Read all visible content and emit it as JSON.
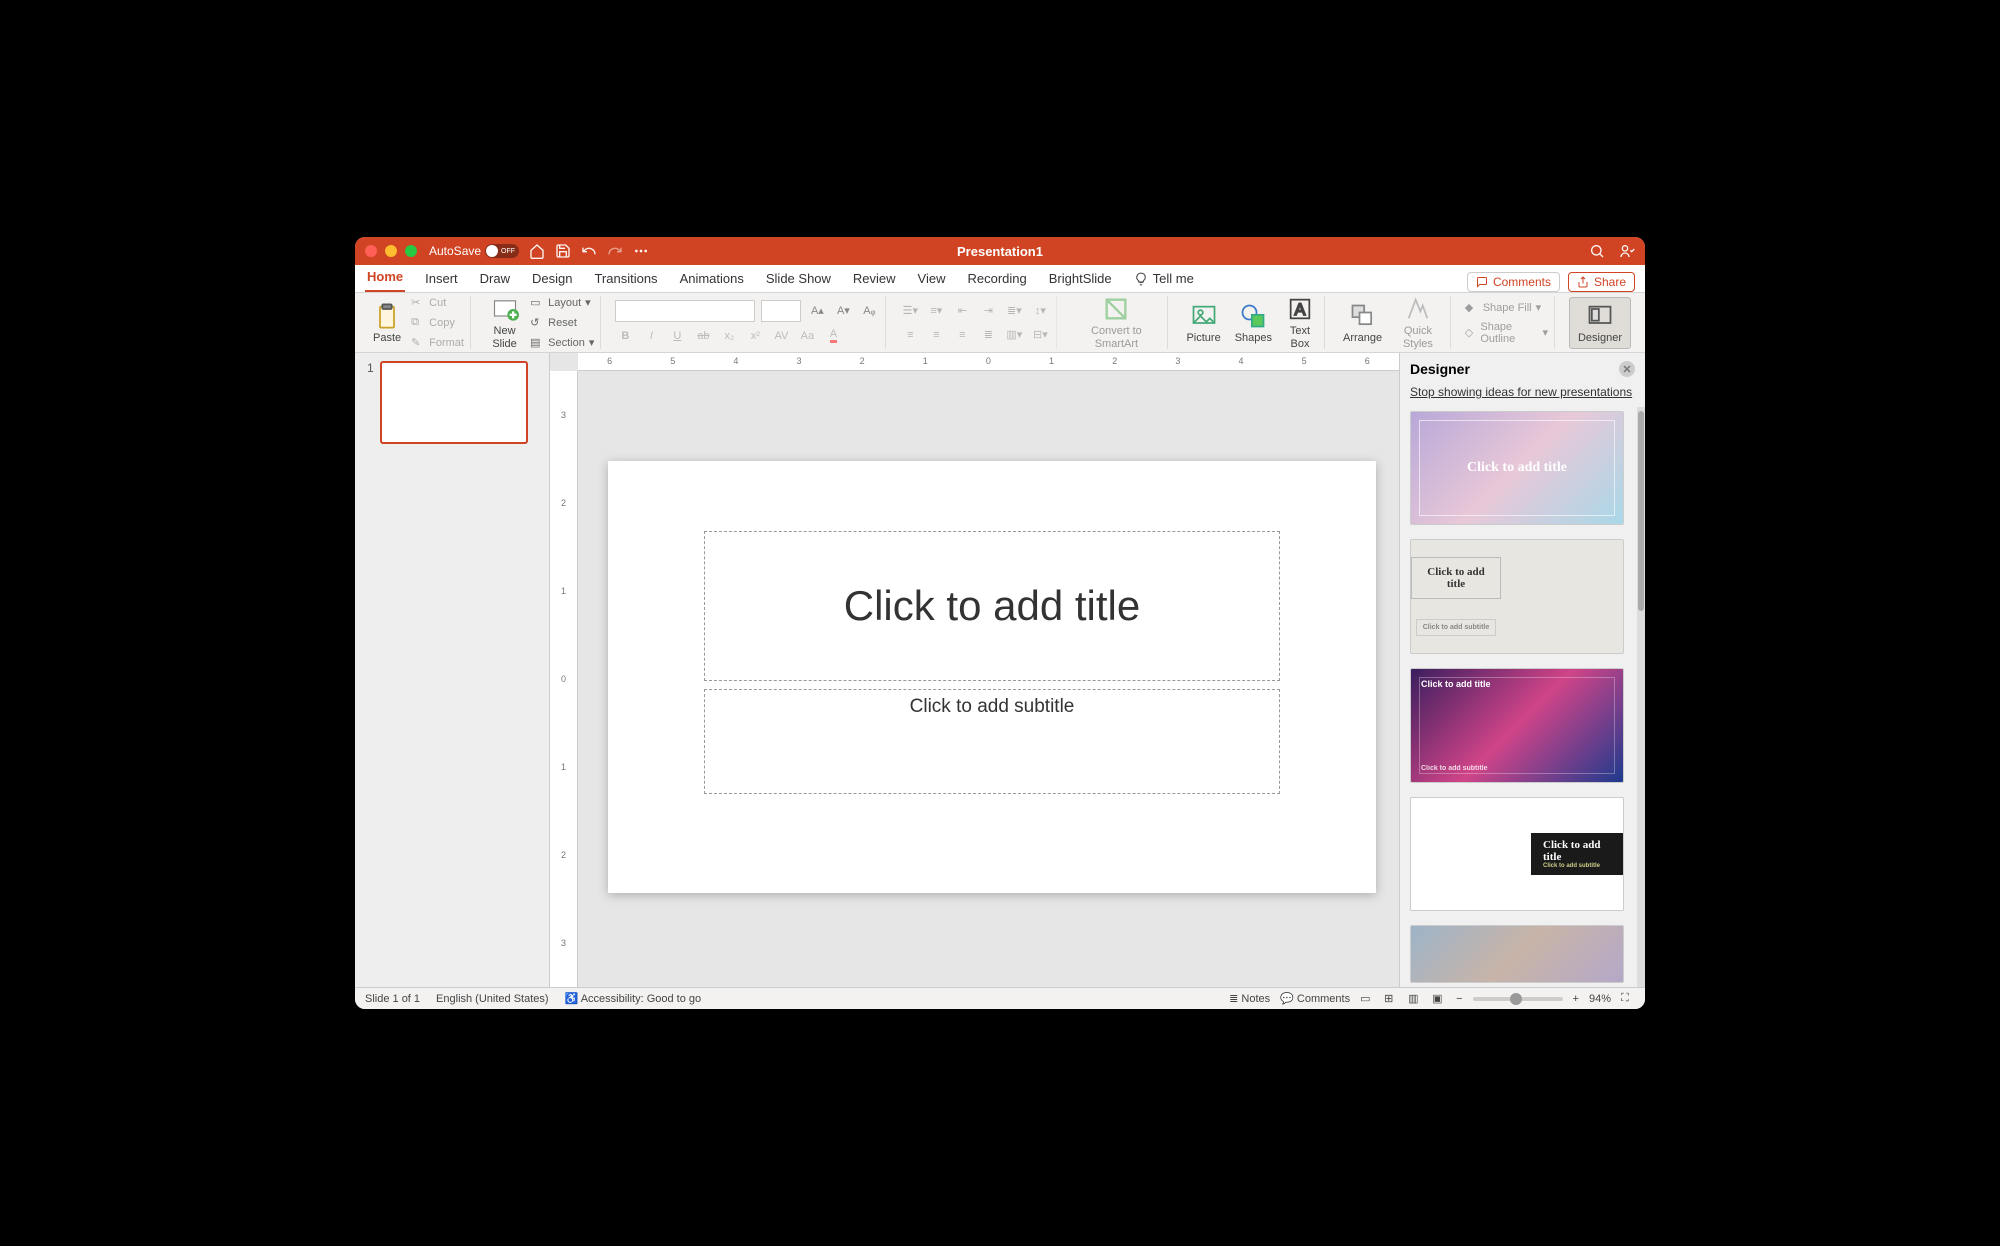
{
  "titlebar": {
    "autosave": "AutoSave",
    "autosave_state": "OFF",
    "title": "Presentation1"
  },
  "tabs": [
    "Home",
    "Insert",
    "Draw",
    "Design",
    "Transitions",
    "Animations",
    "Slide Show",
    "Review",
    "View",
    "Recording",
    "BrightSlide",
    "Tell me"
  ],
  "toolbar": {
    "comments": "Comments",
    "share": "Share"
  },
  "ribbon": {
    "paste": "Paste",
    "cut": "Cut",
    "copy": "Copy",
    "format": "Format",
    "new_slide": "New\nSlide",
    "layout": "Layout",
    "reset": "Reset",
    "section": "Section",
    "smartart": "Convert to\nSmartArt",
    "picture": "Picture",
    "shapes": "Shapes",
    "textbox": "Text\nBox",
    "arrange": "Arrange",
    "quick_styles": "Quick\nStyles",
    "shape_fill": "Shape Fill",
    "shape_outline": "Shape Outline",
    "designer": "Designer"
  },
  "thumbnails": [
    {
      "number": "1"
    }
  ],
  "slide": {
    "title_placeholder": "Click to add title",
    "subtitle_placeholder": "Click to add subtitle"
  },
  "designer": {
    "title": "Designer",
    "stop_link": "Stop showing ideas for new presentations",
    "ideas": [
      {
        "title": "Click to add title"
      },
      {
        "title": "Click to add title",
        "subtitle": "Click to add subtitle"
      },
      {
        "title": "Click to add title",
        "subtitle": "Click to add subtitle"
      },
      {
        "title": "Click to add title",
        "subtitle": "Click to add subtitle"
      }
    ]
  },
  "status": {
    "slide_counter": "Slide 1 of 1",
    "language": "English (United States)",
    "accessibility": "Accessibility: Good to go",
    "notes": "Notes",
    "comments": "Comments",
    "zoom": "94%"
  }
}
